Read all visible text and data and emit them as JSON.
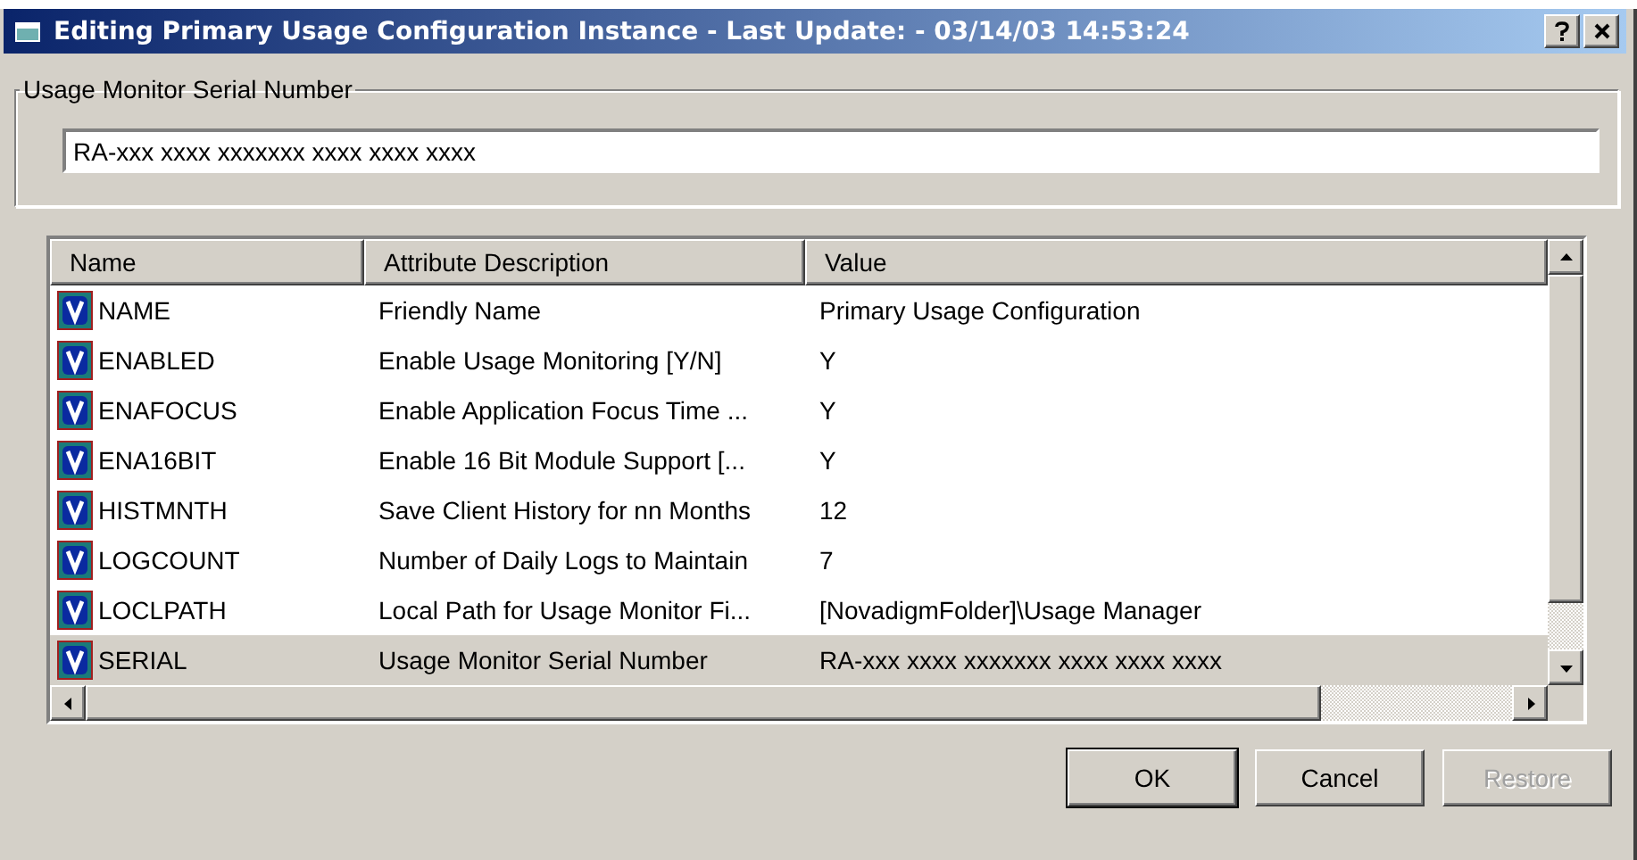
{
  "window": {
    "title": "Editing Primary Usage Configuration Instance - Last Update: - 03/14/03 14:53:24"
  },
  "serial_group": {
    "label": "Usage Monitor Serial Number",
    "value": "RA-xxx xxxx xxxxxxx xxxx xxxx xxxx"
  },
  "table": {
    "columns": [
      "Name",
      "Attribute Description",
      "Value"
    ],
    "rows": [
      {
        "name": "NAME",
        "description": "Friendly Name",
        "value": "Primary Usage Configuration",
        "selected": false
      },
      {
        "name": "ENABLED",
        "description": "Enable Usage Monitoring [Y/N]",
        "value": "Y",
        "selected": false
      },
      {
        "name": "ENAFOCUS",
        "description": "Enable Application Focus Time ...",
        "value": "Y",
        "selected": false
      },
      {
        "name": "ENA16BIT",
        "description": "Enable 16 Bit Module Support [...",
        "value": "Y",
        "selected": false
      },
      {
        "name": "HISTMNTH",
        "description": "Save Client History for nn Months",
        "value": "12",
        "selected": false
      },
      {
        "name": "LOGCOUNT",
        "description": "Number of Daily Logs to Maintain",
        "value": "7",
        "selected": false
      },
      {
        "name": "LOCLPATH",
        "description": "Local Path for Usage Monitor Fi...",
        "value": "[NovadigmFolder]\\Usage Manager",
        "selected": false
      },
      {
        "name": "SERIAL",
        "description": "Usage Monitor Serial Number",
        "value": "RA-xxx xxxx xxxxxxx xxxx xxxx xxxx",
        "selected": true
      }
    ]
  },
  "buttons": [
    {
      "label": "OK",
      "default": true,
      "disabled": false
    },
    {
      "label": "Cancel",
      "default": false,
      "disabled": false
    },
    {
      "label": "Restore",
      "default": false,
      "disabled": true
    }
  ]
}
